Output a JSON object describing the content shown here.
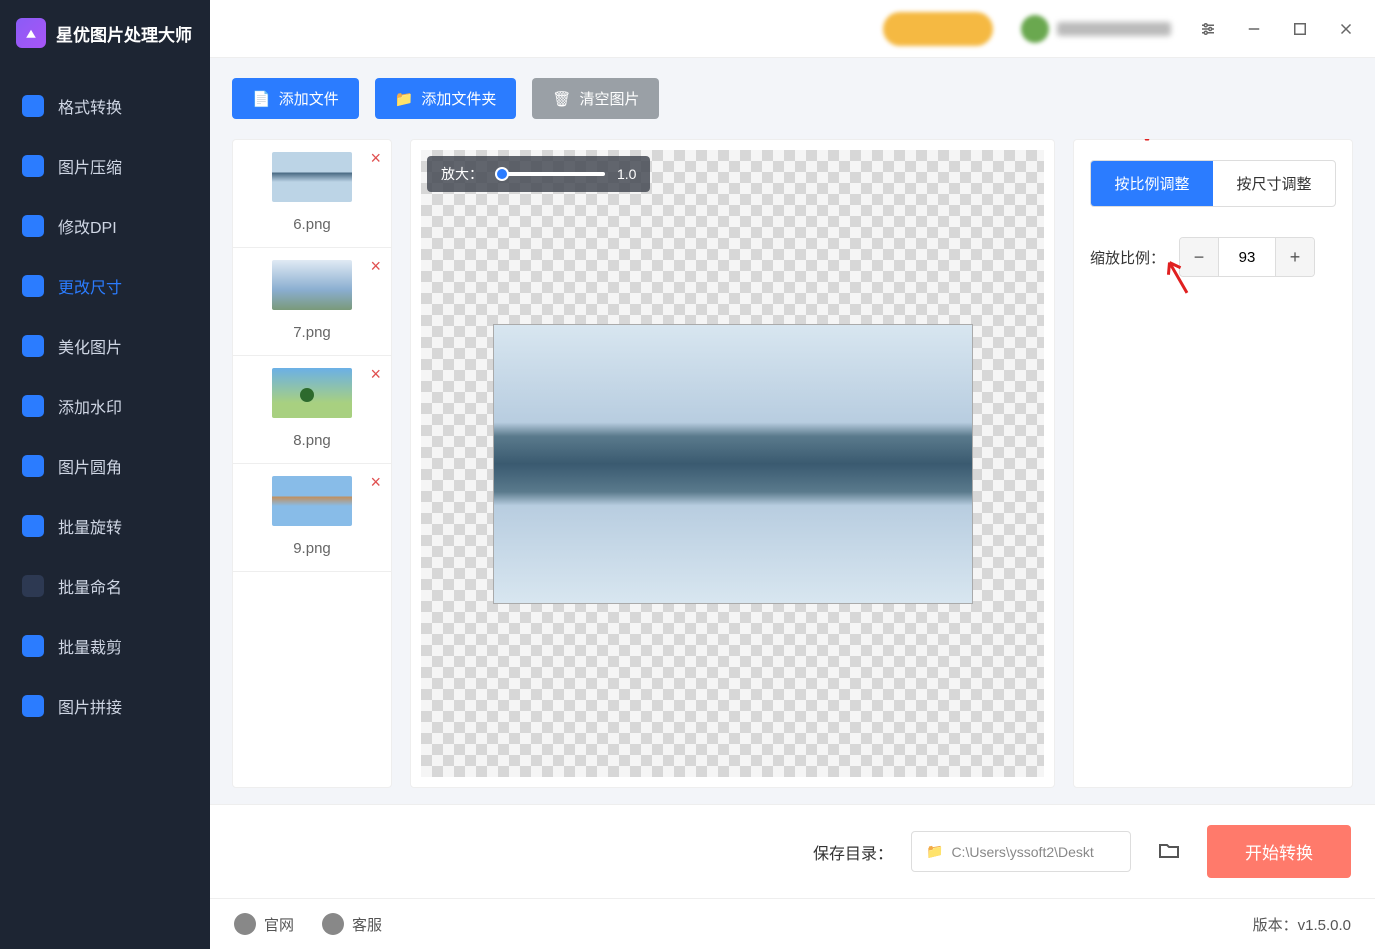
{
  "app_title": "星优图片处理大师",
  "sidebar": {
    "items": [
      {
        "label": "格式转换"
      },
      {
        "label": "图片压缩"
      },
      {
        "label": "修改DPI"
      },
      {
        "label": "更改尺寸"
      },
      {
        "label": "美化图片"
      },
      {
        "label": "添加水印"
      },
      {
        "label": "图片圆角"
      },
      {
        "label": "批量旋转"
      },
      {
        "label": "批量命名"
      },
      {
        "label": "批量裁剪"
      },
      {
        "label": "图片拼接"
      }
    ],
    "active_index": 3
  },
  "toolbar": {
    "add_file": "添加文件",
    "add_folder": "添加文件夹",
    "clear": "清空图片"
  },
  "files": [
    {
      "name": "6.png"
    },
    {
      "name": "7.png"
    },
    {
      "name": "8.png"
    },
    {
      "name": "9.png"
    }
  ],
  "zoom": {
    "label": "放大：",
    "value": "1.0"
  },
  "panel": {
    "tab_ratio": "按比例调整",
    "tab_size": "按尺寸调整",
    "ratio_label": "缩放比例：",
    "ratio_value": "93"
  },
  "savebar": {
    "label": "保存目录：",
    "path": "C:\\Users\\yssoft2\\Deskt",
    "start": "开始转换"
  },
  "footer": {
    "site": "官网",
    "support": "客服",
    "version_label": "版本：",
    "version": "v1.5.0.0"
  }
}
